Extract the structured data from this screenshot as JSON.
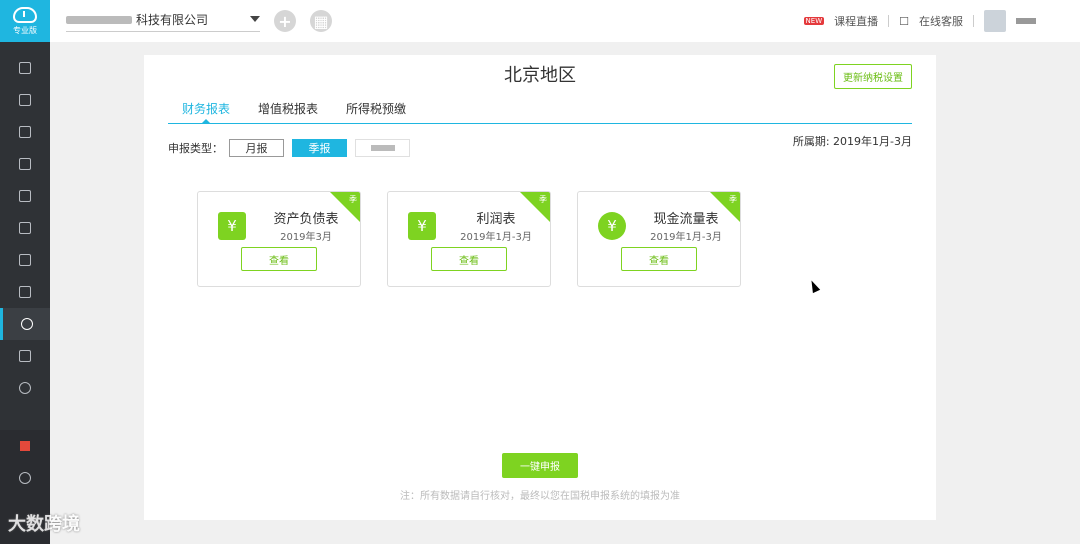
{
  "sidebar": {
    "logo_label": "专业版",
    "items": [
      {
        "icon": "document-icon"
      },
      {
        "icon": "receipt-icon"
      },
      {
        "icon": "chart-icon"
      },
      {
        "icon": "ledger-icon"
      },
      {
        "icon": "calendar-icon"
      },
      {
        "icon": "report-icon"
      },
      {
        "icon": "shop-icon"
      },
      {
        "icon": "image-icon"
      },
      {
        "icon": "tax-icon",
        "active": true
      },
      {
        "icon": "edit-icon"
      },
      {
        "icon": "settings-icon"
      }
    ],
    "bottom_items": [
      {
        "icon": "gift-icon"
      },
      {
        "icon": "speed-icon"
      }
    ]
  },
  "watermark": "大数跨境",
  "topbar": {
    "company_name": "科技有限公司",
    "live_course": "课程直播",
    "new_tag": "NEW",
    "online_service": "在线客服"
  },
  "main": {
    "region_title": "北京地区",
    "update_button": "更新纳税设置",
    "tabs": [
      {
        "label": "财务报表",
        "active": true
      },
      {
        "label": "增值税报表"
      },
      {
        "label": "所得税预缴"
      }
    ],
    "period_label": "申报类型：",
    "period_types": [
      {
        "label": "月报"
      },
      {
        "label": "季报",
        "active": true
      }
    ],
    "period_info": "所属期: 2019年1月-3月",
    "cards": [
      {
        "title": "资产负债表",
        "date": "2019年3月",
        "badge": "季",
        "view": "查看",
        "icon": "yuan-wallet-icon"
      },
      {
        "title": "利润表",
        "date": "2019年1月-3月",
        "badge": "季",
        "view": "查看",
        "icon": "shop-yuan-icon"
      },
      {
        "title": "现金流量表",
        "date": "2019年1月-3月",
        "badge": "季",
        "view": "查看",
        "icon": "coins-yuan-icon"
      }
    ],
    "submit_button": "一键申报",
    "note": "注：所有数据请自行核对，最终以您在国税申报系统的填报为准"
  }
}
